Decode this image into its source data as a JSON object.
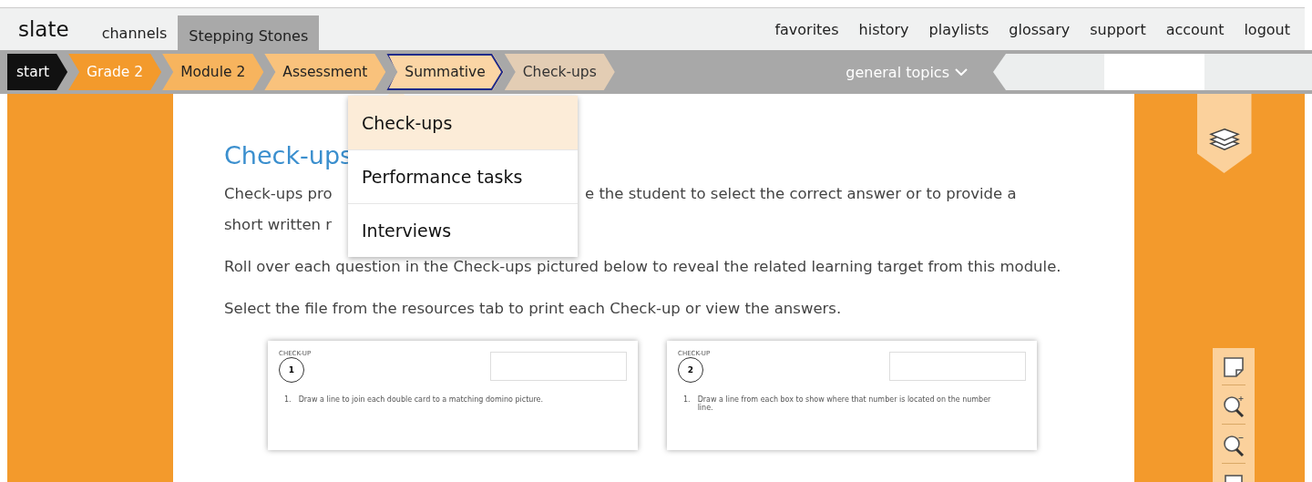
{
  "topnav": {
    "logo": "slate",
    "left": [
      {
        "label": "channels",
        "selected": false
      },
      {
        "label": "Stepping Stones",
        "selected": true
      }
    ],
    "right": [
      "favorites",
      "history",
      "playlists",
      "glossary",
      "support",
      "account",
      "logout"
    ]
  },
  "breadcrumbs": [
    {
      "label": "start",
      "selected": false
    },
    {
      "label": "Grade 2",
      "selected": false
    },
    {
      "label": "Module 2",
      "selected": false
    },
    {
      "label": "Assessment",
      "selected": false
    },
    {
      "label": "Summative",
      "selected": true
    },
    {
      "label": "Check-ups",
      "selected": false
    }
  ],
  "topics_menu": "general topics",
  "dropdown": [
    {
      "label": "Check-ups",
      "selected": true
    },
    {
      "label": "Performance tasks",
      "selected": false
    },
    {
      "label": "Interviews",
      "selected": false
    }
  ],
  "content": {
    "heading": "Check-ups",
    "intro_line1_start": "Check-ups pro",
    "intro_line1_end": "e the student to select the correct answer or to provide a",
    "intro_line2": "short written r",
    "paragraphs": [
      "Roll over each question in the Check-ups pictured below to reveal the related learning target from this module.",
      "Select the file from the resources tab to print each Check-up or view the answers."
    ],
    "documents": [
      {
        "label": "CHECK-UP",
        "number": "1",
        "question_number": "1.",
        "question": "Draw a line to join each double card to a matching domino picture."
      },
      {
        "label": "CHECK-UP",
        "number": "2",
        "question_number": "1.",
        "question": "Draw a line from each box to show where that number is located on the number line."
      }
    ]
  }
}
